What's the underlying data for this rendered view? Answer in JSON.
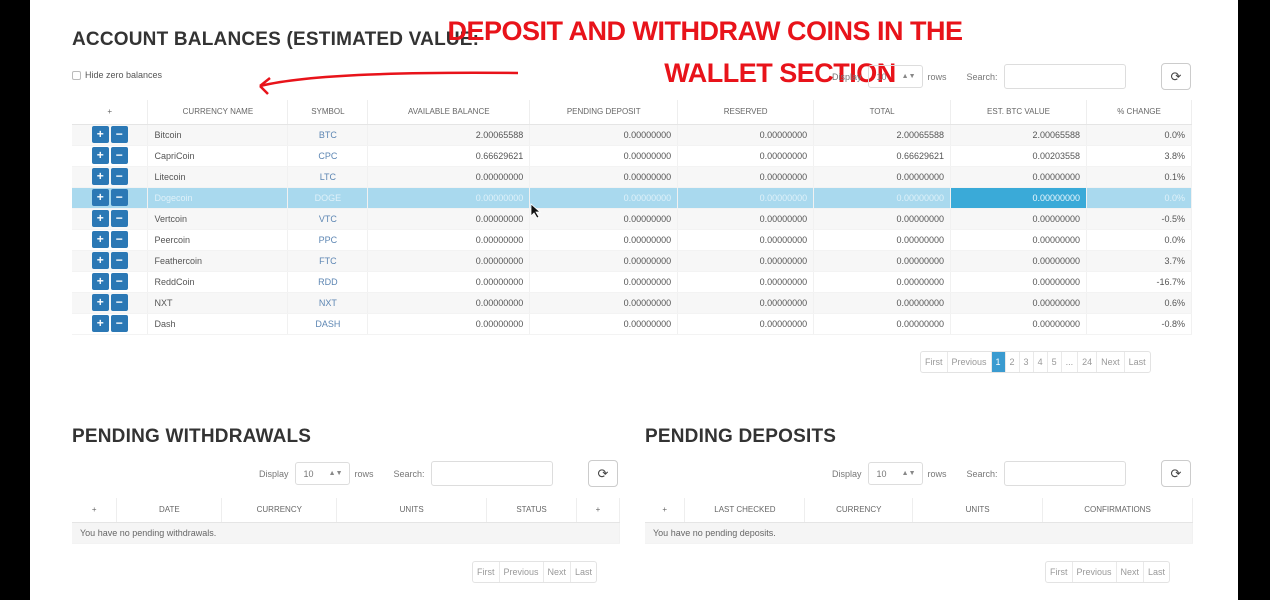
{
  "balances": {
    "title": "ACCOUNT BALANCES (ESTIMATED VALUE:",
    "hide_zero_label": "Hide zero balances",
    "display_label": "Display",
    "display_value": "10",
    "rows_label": "rows",
    "search_label": "Search:",
    "columns": [
      "+",
      "CURRENCY NAME",
      "SYMBOL",
      "AVAILABLE BALANCE",
      "PENDING DEPOSIT",
      "RESERVED",
      "TOTAL",
      "EST. BTC VALUE",
      "% CHANGE"
    ],
    "rows": [
      {
        "name": "Bitcoin",
        "symbol": "BTC",
        "available": "2.00065588",
        "pending": "0.00000000",
        "reserved": "0.00000000",
        "total": "2.00065588",
        "btc": "2.00065588",
        "change": "0.0%"
      },
      {
        "name": "CapriCoin",
        "symbol": "CPC",
        "available": "0.66629621",
        "pending": "0.00000000",
        "reserved": "0.00000000",
        "total": "0.66629621",
        "btc": "0.00203558",
        "change": "3.8%"
      },
      {
        "name": "Litecoin",
        "symbol": "LTC",
        "available": "0.00000000",
        "pending": "0.00000000",
        "reserved": "0.00000000",
        "total": "0.00000000",
        "btc": "0.00000000",
        "change": "0.1%"
      },
      {
        "name": "Dogecoin",
        "symbol": "DOGE",
        "available": "0.00000000",
        "pending": "0.00000000",
        "reserved": "0.00000000",
        "total": "0.00000000",
        "btc": "0.00000000",
        "change": "0.0%"
      },
      {
        "name": "Vertcoin",
        "symbol": "VTC",
        "available": "0.00000000",
        "pending": "0.00000000",
        "reserved": "0.00000000",
        "total": "0.00000000",
        "btc": "0.00000000",
        "change": "-0.5%"
      },
      {
        "name": "Peercoin",
        "symbol": "PPC",
        "available": "0.00000000",
        "pending": "0.00000000",
        "reserved": "0.00000000",
        "total": "0.00000000",
        "btc": "0.00000000",
        "change": "0.0%"
      },
      {
        "name": "Feathercoin",
        "symbol": "FTC",
        "available": "0.00000000",
        "pending": "0.00000000",
        "reserved": "0.00000000",
        "total": "0.00000000",
        "btc": "0.00000000",
        "change": "3.7%"
      },
      {
        "name": "ReddCoin",
        "symbol": "RDD",
        "available": "0.00000000",
        "pending": "0.00000000",
        "reserved": "0.00000000",
        "total": "0.00000000",
        "btc": "0.00000000",
        "change": "-16.7%"
      },
      {
        "name": "NXT",
        "symbol": "NXT",
        "available": "0.00000000",
        "pending": "0.00000000",
        "reserved": "0.00000000",
        "total": "0.00000000",
        "btc": "0.00000000",
        "change": "0.6%"
      },
      {
        "name": "Dash",
        "symbol": "DASH",
        "available": "0.00000000",
        "pending": "0.00000000",
        "reserved": "0.00000000",
        "total": "0.00000000",
        "btc": "0.00000000",
        "change": "-0.8%"
      }
    ],
    "pager": [
      "First",
      "Previous",
      "1",
      "2",
      "3",
      "4",
      "5",
      "...",
      "24",
      "Next",
      "Last"
    ],
    "active_page": "1"
  },
  "annotation": {
    "line1": "DEPOSIT AND WITHDRAW COINS IN THE",
    "line2": "WALLET SECTION",
    "color": "#e8131a"
  },
  "withdrawals": {
    "title": "PENDING WITHDRAWALS",
    "display_label": "Display",
    "display_value": "10",
    "rows_label": "rows",
    "search_label": "Search:",
    "columns": [
      "+",
      "DATE",
      "CURRENCY",
      "UNITS",
      "STATUS",
      "+"
    ],
    "empty": "You have no pending withdrawals.",
    "pager": [
      "First",
      "Previous",
      "Next",
      "Last"
    ]
  },
  "deposits": {
    "title": "PENDING DEPOSITS",
    "display_label": "Display",
    "display_value": "10",
    "rows_label": "rows",
    "search_label": "Search:",
    "columns": [
      "+",
      "LAST CHECKED",
      "CURRENCY",
      "UNITS",
      "CONFIRMATIONS"
    ],
    "empty": "You have no pending deposits.",
    "pager": [
      "First",
      "Previous",
      "Next",
      "Last"
    ]
  },
  "icons": {
    "plus": "+",
    "minus": "−",
    "refresh": "⟳"
  },
  "colors": {
    "accent": "#2b78b5",
    "selected_row": "#a9d9ee",
    "selected_cell": "#3aaad8"
  }
}
